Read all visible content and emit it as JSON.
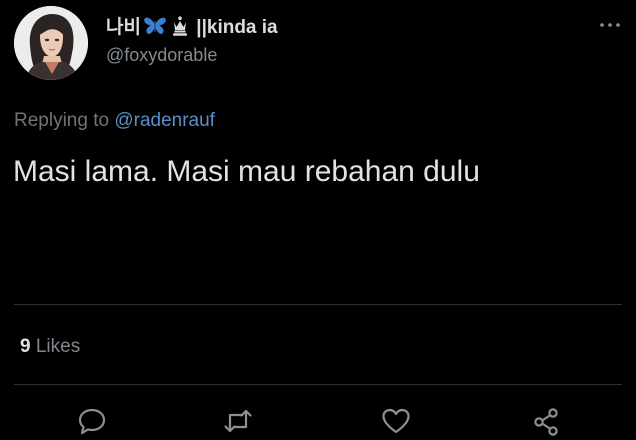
{
  "user": {
    "display_name_prefix": "나비",
    "display_name_emojis": [
      "butterfly-icon",
      "chess-queen-icon"
    ],
    "display_name_suffix": " ||kinda ia",
    "handle": "@foxydorable"
  },
  "reply": {
    "prefix": "Replying to ",
    "mention": "@radenrauf"
  },
  "tweet": {
    "text": "Masi lama. Masi mau rebahan dulu"
  },
  "stats": {
    "likes_count": "9",
    "likes_label": "Likes"
  },
  "actions": [
    "reply-icon",
    "retweet-icon",
    "like-icon",
    "share-icon"
  ],
  "colors": {
    "background": "#000000",
    "text": "#e2e2e2",
    "secondary_text": "#858b90",
    "link": "#5b8fc7",
    "divider": "#2d2f32",
    "icon": "#8b9095",
    "butterfly": "#3d7fd6"
  }
}
